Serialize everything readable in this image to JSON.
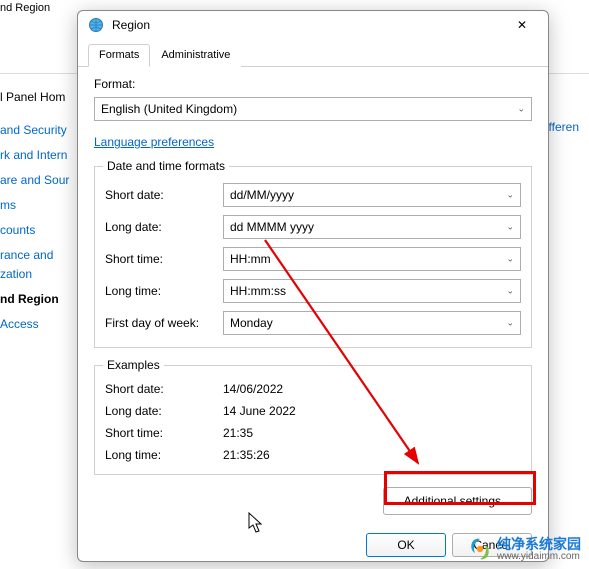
{
  "background": {
    "window_title_fragment": "nd Region",
    "control_panel_home": "l Panel Hom",
    "right_link_fragment": "differen",
    "sidebar": [
      "and Security",
      "rk and Intern",
      "are and Sour",
      "ms",
      "counts",
      "rance and",
      "zation",
      "nd Region",
      "Access"
    ]
  },
  "dialog": {
    "title": "Region",
    "close_icon": "✕",
    "tabs": {
      "formats": "Formats",
      "administrative": "Administrative"
    },
    "format_label": "Format:",
    "format_value": "English (United Kingdom)",
    "language_link": "Language preferences",
    "group_datetime_title": "Date and time formats",
    "short_date_label": "Short date:",
    "short_date_value": "dd/MM/yyyy",
    "long_date_label": "Long date:",
    "long_date_value": "dd MMMM yyyy",
    "short_time_label": "Short time:",
    "short_time_value": "HH:mm",
    "long_time_label": "Long time:",
    "long_time_value": "HH:mm:ss",
    "first_day_label": "First day of week:",
    "first_day_value": "Monday",
    "group_examples_title": "Examples",
    "ex_short_date_label": "Short date:",
    "ex_short_date_value": "14/06/2022",
    "ex_long_date_label": "Long date:",
    "ex_long_date_value": "14 June 2022",
    "ex_short_time_label": "Short time:",
    "ex_short_time_value": "21:35",
    "ex_long_time_label": "Long time:",
    "ex_long_time_value": "21:35:26",
    "additional_btn": "Additional settings...",
    "ok_btn": "OK",
    "cancel_btn": "Cancel"
  },
  "watermark": {
    "zh": "纯净系统家园",
    "url": "www.yidaimm.com"
  }
}
